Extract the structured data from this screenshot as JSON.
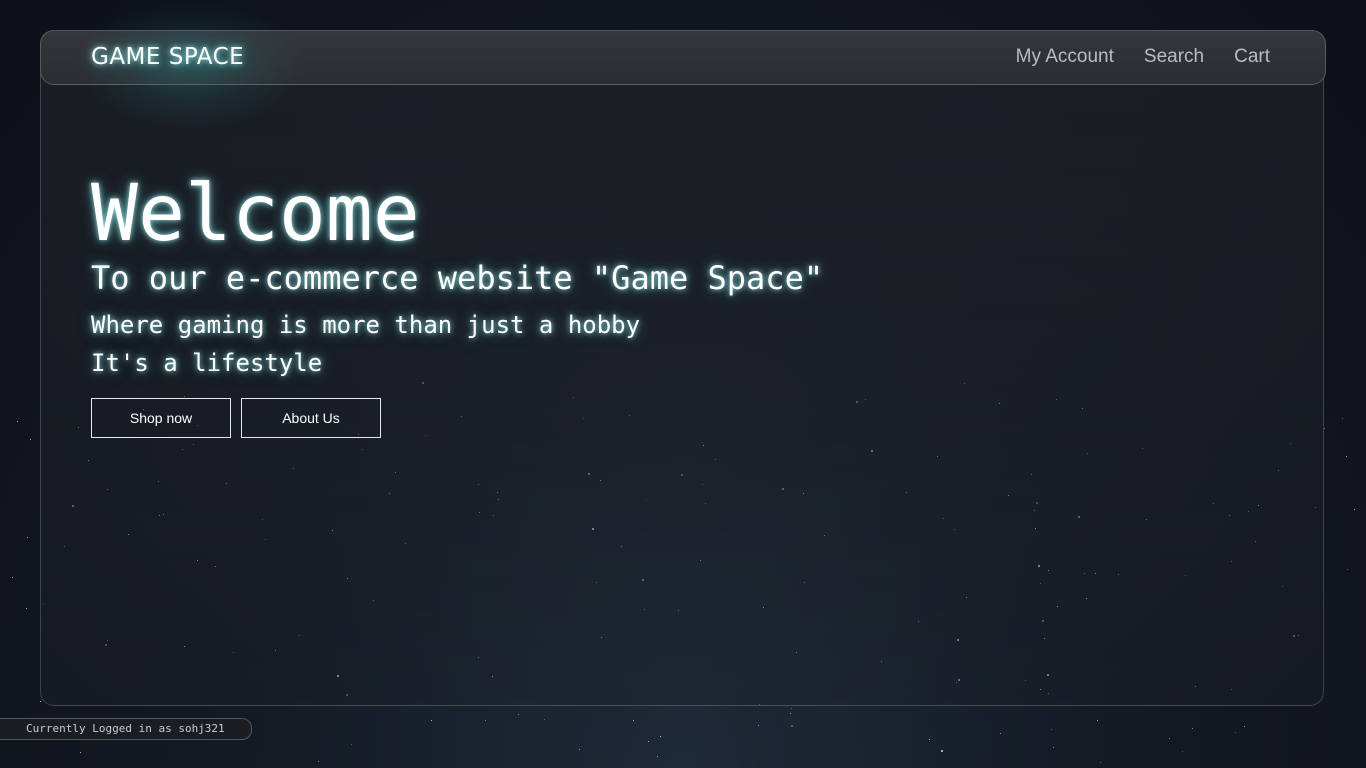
{
  "header": {
    "logo": "GAME SPACE",
    "nav": [
      "My Account",
      "Search",
      "Cart"
    ]
  },
  "hero": {
    "title": "Welcome",
    "subtitle": "To our e-commerce website \"Game Space\"",
    "line1": "Where gaming is more than just a hobby",
    "line2": "It's a lifestyle"
  },
  "buttons": {
    "shop": "Shop now",
    "about": "About Us"
  },
  "status": {
    "text": "Currently Logged in as sohj321"
  },
  "colors": {
    "background": "#141a24",
    "glow": "#5adcdc",
    "text": "#ffffff",
    "nav_text": "#b9bcc2"
  }
}
